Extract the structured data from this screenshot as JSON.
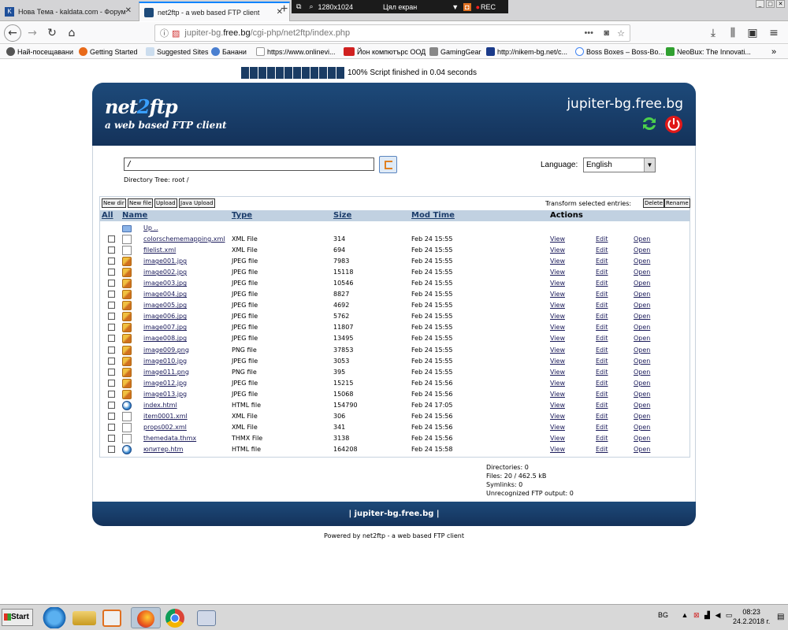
{
  "browser": {
    "tabs": [
      {
        "label": "Нова Тема - kaldata.com - Форум"
      },
      {
        "label": "net2ftp - a web based FTP client"
      }
    ],
    "recorder": {
      "resolution": "1280x1024",
      "mode": "Цял екран",
      "rec": "REC"
    },
    "url": {
      "pre": "jupiter-bg.",
      "domain": "free.bg",
      "post": "/cgi-php/net2ftp/index.php"
    },
    "bookmarks": [
      "Най-посещавани",
      "Getting Started",
      "Suggested Sites",
      "Банани",
      "https://www.onlinevi...",
      "Йон компютърс ООД",
      "GamingGear",
      "http://nikem-bg.net/c...",
      "Boss Boxes – Boss-Bo...",
      "NeoBux: The Innovati..."
    ]
  },
  "page": {
    "progress": "100% Script finished in 0.04 seconds",
    "logo": {
      "part1": "net",
      "part2": "2",
      "part3": "ftp",
      "sub": "a web based FTP client"
    },
    "site": "jupiter-bg.free.bg",
    "directory": "/",
    "directory_tree": "Directory Tree: root /",
    "language_label": "Language:",
    "language_value": "English",
    "toolbar": {
      "new_dir": "New dir",
      "new_file": "New file",
      "upload": "Upload",
      "java_upload": "Java Upload",
      "transform_label": "Transform selected entries:",
      "delete": "Delete",
      "rename": "Rename"
    },
    "columns": {
      "all": "All",
      "name": "Name",
      "type": "Type",
      "size": "Size",
      "mod_time": "Mod Time",
      "actions": "Actions"
    },
    "up": "Up ..",
    "actions": {
      "view": "View",
      "edit": "Edit",
      "open": "Open"
    },
    "files": [
      {
        "icon": "doc",
        "name": "colorschememapping.xml",
        "type": "XML File",
        "size": "314",
        "mod": "Feb 24 15:55"
      },
      {
        "icon": "doc",
        "name": "filelist.xml",
        "type": "XML File",
        "size": "694",
        "mod": "Feb 24 15:55"
      },
      {
        "icon": "img",
        "name": "image001.jpg",
        "type": "JPEG file",
        "size": "7983",
        "mod": "Feb 24 15:55"
      },
      {
        "icon": "img",
        "name": "image002.jpg",
        "type": "JPEG file",
        "size": "15118",
        "mod": "Feb 24 15:55"
      },
      {
        "icon": "img",
        "name": "image003.jpg",
        "type": "JPEG file",
        "size": "10546",
        "mod": "Feb 24 15:55"
      },
      {
        "icon": "img",
        "name": "image004.jpg",
        "type": "JPEG file",
        "size": "8827",
        "mod": "Feb 24 15:55"
      },
      {
        "icon": "img",
        "name": "image005.jpg",
        "type": "JPEG file",
        "size": "4692",
        "mod": "Feb 24 15:55"
      },
      {
        "icon": "img",
        "name": "image006.jpg",
        "type": "JPEG file",
        "size": "5762",
        "mod": "Feb 24 15:55"
      },
      {
        "icon": "img",
        "name": "image007.jpg",
        "type": "JPEG file",
        "size": "11807",
        "mod": "Feb 24 15:55"
      },
      {
        "icon": "img",
        "name": "image008.jpg",
        "type": "JPEG file",
        "size": "13495",
        "mod": "Feb 24 15:55"
      },
      {
        "icon": "img",
        "name": "image009.png",
        "type": "PNG file",
        "size": "37853",
        "mod": "Feb 24 15:55"
      },
      {
        "icon": "img",
        "name": "image010.jpg",
        "type": "JPEG file",
        "size": "3053",
        "mod": "Feb 24 15:55"
      },
      {
        "icon": "img",
        "name": "image011.png",
        "type": "PNG file",
        "size": "395",
        "mod": "Feb 24 15:55"
      },
      {
        "icon": "img",
        "name": "image012.jpg",
        "type": "JPEG file",
        "size": "15215",
        "mod": "Feb 24 15:56"
      },
      {
        "icon": "img",
        "name": "image013.jpg",
        "type": "JPEG file",
        "size": "15068",
        "mod": "Feb 24 15:56"
      },
      {
        "icon": "web",
        "name": "index.html",
        "type": "HTML file",
        "size": "154790",
        "mod": "Feb 24 17:05"
      },
      {
        "icon": "doc",
        "name": "item0001.xml",
        "type": "XML File",
        "size": "306",
        "mod": "Feb 24 15:56"
      },
      {
        "icon": "doc",
        "name": "props002.xml",
        "type": "XML File",
        "size": "341",
        "mod": "Feb 24 15:56"
      },
      {
        "icon": "doc",
        "name": "themedata.thmx",
        "type": "THMX File",
        "size": "3138",
        "mod": "Feb 24 15:56"
      },
      {
        "icon": "web",
        "name": "юпитер.htm",
        "type": "HTML file",
        "size": "164208",
        "mod": "Feb 24 15:58"
      }
    ],
    "stats": {
      "directories": "Directories: 0",
      "files": "Files: 20 / 462.5 kB",
      "symlinks": "Symlinks: 0",
      "unrecognized": "Unrecognized FTP output: 0"
    },
    "footer": "| jupiter-bg.free.bg |",
    "powered": "Powered by net2ftp - a web based FTP client"
  },
  "taskbar": {
    "start": "Start",
    "lang": "BG",
    "time": "08:23",
    "date": "24.2.2018 г."
  }
}
